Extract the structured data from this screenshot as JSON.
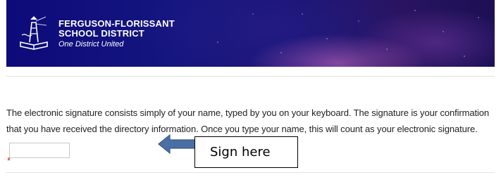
{
  "header": {
    "line1": "FERGUSON-FLORISSANT",
    "line2": "SCHOOL DISTRICT",
    "tagline": "One District United",
    "logo_icon": "lighthouse-book-icon"
  },
  "form": {
    "text_part1": "The electronic signature consists simply of your name, typed by you on your keyboard.  The signature is your confirmation that you have received the directory information.  Once you type your name, this will count as your electronic signature.",
    "signature_value": "",
    "required_marker": "*"
  },
  "annotation": {
    "label": "Sign here",
    "arrow_icon": "left-arrow-icon",
    "arrow_color": "#4a6fa5"
  },
  "colors": {
    "banner_dark": "#0d0a7a",
    "required": "#d42020"
  }
}
